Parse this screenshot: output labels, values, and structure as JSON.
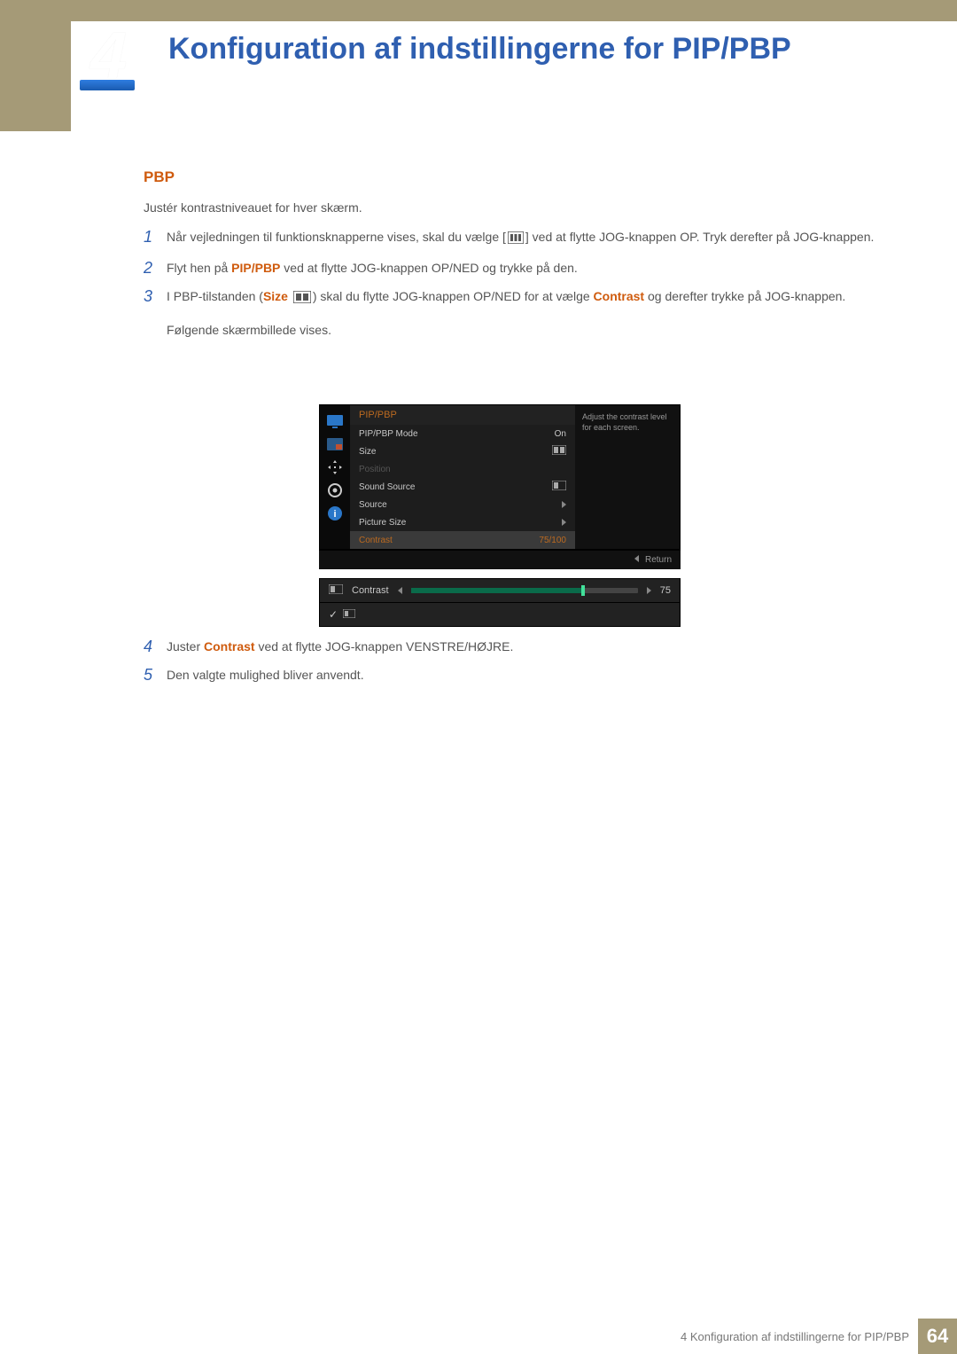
{
  "chapter": {
    "number": "4",
    "title": "Konfiguration af indstillingerne for PIP/PBP"
  },
  "section": {
    "heading": "PBP",
    "intro": "Justér kontrastniveauet for hver skærm."
  },
  "steps": [
    {
      "num": "1",
      "text_a": "Når vejledningen til funktionsknapperne vises, skal du vælge [",
      "text_b": "] ved at flytte JOG-knappen OP. Tryk derefter på JOG-knappen."
    },
    {
      "num": "2",
      "text_a": "Flyt hen på ",
      "highlight1": "PIP/PBP",
      "text_b": " ved at flytte JOG-knappen OP/NED og trykke på den."
    },
    {
      "num": "3",
      "text_a": "I PBP-tilstanden (",
      "highlight1": "Size",
      "text_b": ") skal du flytte JOG-knappen OP/NED for at vælge ",
      "highlight2": "Contrast",
      "text_c": " og derefter trykke på JOG-knappen.",
      "followup": "Følgende skærmbillede vises."
    }
  ],
  "osd": {
    "title": "PIP/PBP",
    "help": "Adjust the contrast level for each screen.",
    "rows": {
      "mode": {
        "label": "PIP/PBP Mode",
        "value": "On"
      },
      "size": {
        "label": "Size"
      },
      "position": {
        "label": "Position"
      },
      "sound": {
        "label": "Sound Source"
      },
      "source": {
        "label": "Source"
      },
      "picsize": {
        "label": "Picture Size"
      },
      "contrast": {
        "label": "Contrast",
        "value": "75/100"
      }
    },
    "return": "Return"
  },
  "slider": {
    "label": "Contrast",
    "value": "75"
  },
  "steps_after": [
    {
      "num": "4",
      "text_a": "Juster ",
      "highlight1": "Contrast",
      "text_b": " ved at flytte JOG-knappen VENSTRE/HØJRE."
    },
    {
      "num": "5",
      "text_a": "Den valgte mulighed bliver anvendt."
    }
  ],
  "footer": {
    "text": "4 Konfiguration af indstillingerne for PIP/PBP",
    "page": "64"
  }
}
